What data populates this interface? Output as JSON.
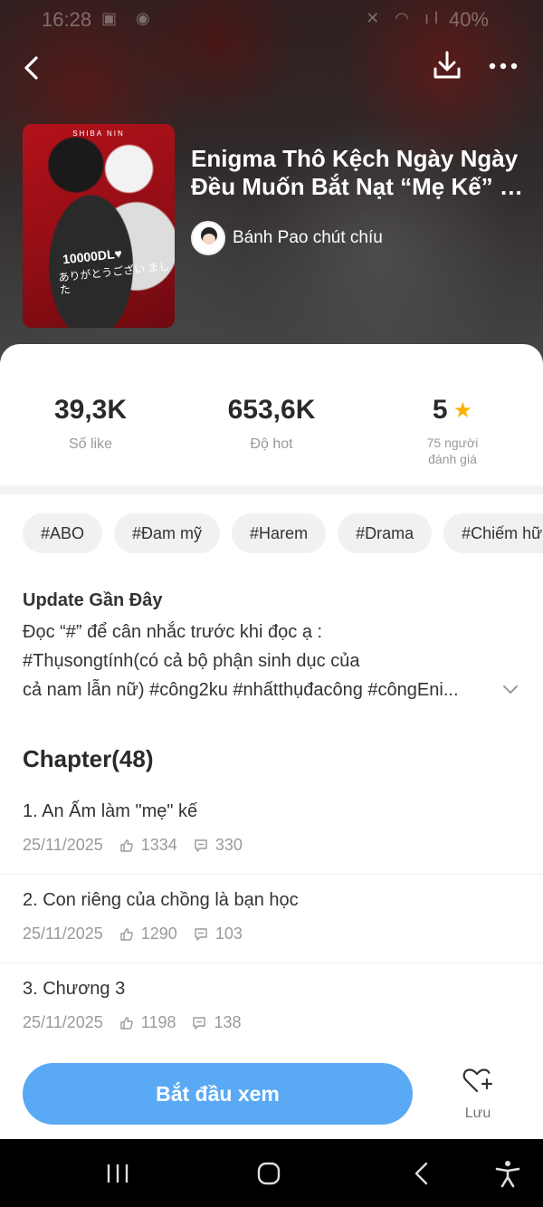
{
  "status_bar": {
    "time": "16:28",
    "battery": "40%"
  },
  "header": {
    "title": "Enigma Thô Kệch Ngày Ngày Đều Muốn Bắt Nạt “Mẹ Kế” …",
    "author": "Bánh Pao chút chíu",
    "cover": {
      "top_text": "SHIBA NIN",
      "line1": "10000DL♥",
      "line2": "ありがとうござい ました"
    }
  },
  "stats": {
    "likes": {
      "value": "39,3K",
      "label": "Số like"
    },
    "hot": {
      "value": "653,6K",
      "label": "Độ hot"
    },
    "rating": {
      "value": "5",
      "label_line1": "75 người",
      "label_line2": "đánh giá"
    }
  },
  "tags": [
    "#ABO",
    "#Đam mỹ",
    "#Harem",
    "#Drama",
    "#Chiếm hữu"
  ],
  "update": {
    "title": "Update Gần Đây",
    "line1": "Đọc “#” để cân nhắc trước khi đọc ạ :",
    "line2": "#Thụsongtính(có cả bộ phận sinh dục của",
    "line3": "cả nam lẫn nữ) #công2ku #nhấtthụđacông #côngEni..."
  },
  "chapters": {
    "header": "Chapter(48)",
    "items": [
      {
        "title": "1. An Ấm làm \"mẹ\" kế",
        "date": "25/11/2025",
        "likes": "1334",
        "comments": "330"
      },
      {
        "title": "2. Con riêng của chồng là bạn học",
        "date": "25/11/2025",
        "likes": "1290",
        "comments": "103"
      },
      {
        "title": "3. Chương 3",
        "date": "25/11/2025",
        "likes": "1198",
        "comments": "138"
      }
    ]
  },
  "actions": {
    "start_label": "Bắt đầu xem",
    "save_label": "Lưu"
  },
  "colors": {
    "accent": "#5aa9f5",
    "star": "#f7b500"
  },
  "icons": [
    "back-arrow-icon",
    "download-icon",
    "more-icon",
    "star-icon",
    "chevron-right-icon",
    "chevron-down-icon",
    "thumbs-up-icon",
    "comment-icon",
    "heart-plus-icon",
    "recents-icon",
    "home-icon",
    "system-back-icon",
    "accessibility-icon"
  ]
}
